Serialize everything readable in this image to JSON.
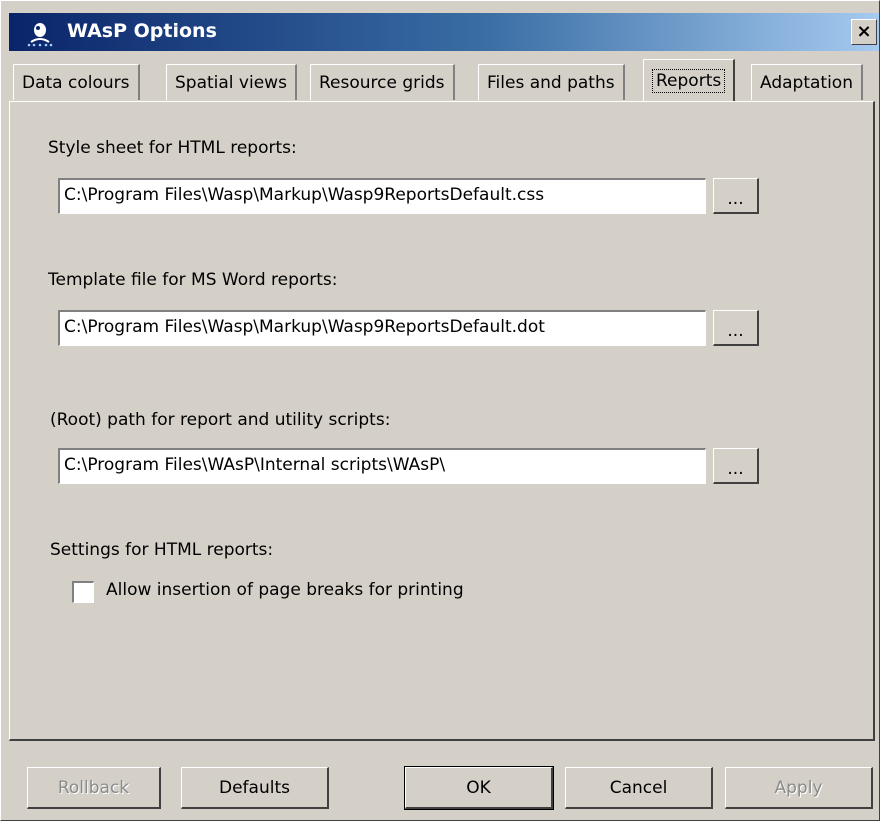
{
  "window": {
    "title": "WAsP Options",
    "close_glyph": "×",
    "icon": "wasp-app-icon"
  },
  "tabs": [
    {
      "label": "Data colours",
      "active": false
    },
    {
      "label": "Spatial views",
      "active": false
    },
    {
      "label": "Resource grids",
      "active": false
    },
    {
      "label": "Files and paths",
      "active": false
    },
    {
      "label": "Reports",
      "active": true
    },
    {
      "label": "Adaptation",
      "active": false
    }
  ],
  "reports": {
    "stylesheet_label": "Style sheet for HTML reports:",
    "stylesheet_value": "C:\\Program Files\\Wasp\\Markup\\Wasp9ReportsDefault.css",
    "template_label": "Template file for MS Word reports:",
    "template_value": "C:\\Program Files\\Wasp\\Markup\\Wasp9ReportsDefault.dot",
    "scripts_label": "(Root) path for report and utility scripts:",
    "scripts_value": "C:\\Program Files\\WAsP\\Internal scripts\\WAsP\\",
    "browse_label": "...",
    "settings_label": "Settings for HTML reports:",
    "page_breaks_label": "Allow insertion of page breaks for printing",
    "page_breaks_checked": false
  },
  "buttons": {
    "rollback": "Rollback",
    "defaults": "Defaults",
    "ok": "OK",
    "cancel": "Cancel",
    "apply": "Apply"
  },
  "colors": {
    "title_start": "#0a246a",
    "title_end": "#a6caf0",
    "face": "#d4d0c8"
  }
}
